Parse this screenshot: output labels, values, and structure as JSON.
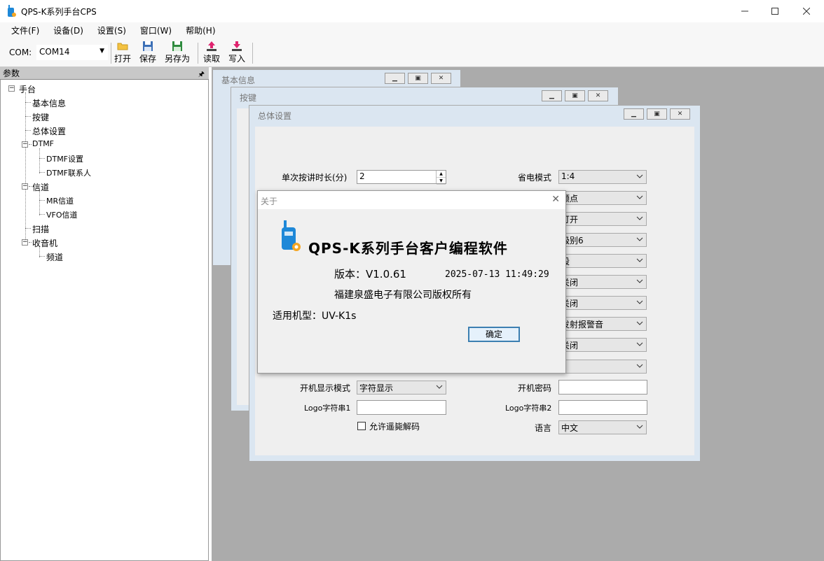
{
  "window": {
    "title": "QPS-K系列手台CPS"
  },
  "menu": [
    "文件(F)",
    "设备(D)",
    "设置(S)",
    "窗口(W)",
    "帮助(H)"
  ],
  "toolbar": {
    "com_label": "COM:",
    "com_value": "COM14",
    "open": "打开",
    "save": "保存",
    "save_as": "另存为",
    "read": "读取",
    "write": "写入"
  },
  "panel": {
    "title": "参数",
    "tree": {
      "root": "手台",
      "basic": "基本信息",
      "keys": "按键",
      "general": "总体设置",
      "dtmf": "DTMF",
      "dtmf_settings": "DTMF设置",
      "dtmf_contacts": "DTMF联系人",
      "channels": "信道",
      "mr_channels": "MR信道",
      "vfo_channels": "VFO信道",
      "scan": "扫描",
      "radio": "收音机",
      "frequency": "频道"
    }
  },
  "windows": {
    "basic": "基本信息",
    "keys": "按键",
    "general": "总体设置"
  },
  "general_form": {
    "ptt_time_label": "单次按讲时长(分)",
    "ptt_time_value": "2",
    "power_save_label": "省电模式",
    "power_save_value": "1:4",
    "r2": "频点",
    "r3": "打开",
    "r4": "级别6",
    "r5": "段",
    "r6": "关闭",
    "r7": "关闭",
    "r8": "发射报警音",
    "r9": "关闭",
    "r10": "",
    "boot_display_label": "开机显示模式",
    "boot_display_value": "字符显示",
    "boot_password_label": "开机密码",
    "boot_password_value": "",
    "logo1_label": "Logo字符串1",
    "logo1_value": "",
    "logo2_label": "Logo字符串2",
    "logo2_value": "",
    "remote_kill_label": "允许遥毙解码",
    "language_label": "语言",
    "language_value": "中文"
  },
  "about": {
    "title": "关于",
    "heading": "QPS-K系列手台客户编程软件",
    "version": "版本：V1.0.61",
    "date": "2025-07-13  11:49:29",
    "copyright": "福建泉盛电子有限公司版权所有",
    "model": "适用机型：UV-K1s",
    "ok": "确定"
  },
  "colors": {
    "mdi_background": "#ababab",
    "mdi_frame": "#dbe6f1",
    "ok_border": "#3c7fb1"
  }
}
